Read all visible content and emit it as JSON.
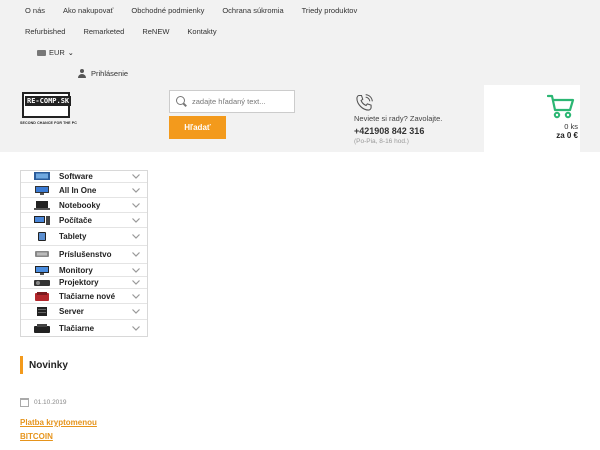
{
  "topnav": {
    "row1": [
      "O nás",
      "Ako nakupovať",
      "Obchodné podmienky",
      "Ochrana súkromia",
      "Triedy produktov"
    ],
    "row2": [
      "Refurbished",
      "Remarketed",
      "ReNEW",
      "Kontakty"
    ]
  },
  "currency": {
    "label": "EUR"
  },
  "account": {
    "login_label": "Prihlásenie"
  },
  "logo": {
    "text": "RE-COMP.SK",
    "tagline": "SECOND CHANCE FOR THE PC"
  },
  "search": {
    "placeholder": "zadajte hľadaný text...",
    "button_label": "Hľadať"
  },
  "contact": {
    "question": "Neviete si rady? Zavolajte.",
    "phone": "+421908 842 316",
    "hours": "(Po-Pia, 8-16 hod.)"
  },
  "cart": {
    "count": "0 ks",
    "total": "za 0 €",
    "accent": "#2bb673"
  },
  "categories": [
    {
      "label": "Software",
      "icon": "software-icon"
    },
    {
      "label": "All In One",
      "icon": "all-in-one-icon"
    },
    {
      "label": "Notebooky",
      "icon": "laptop-icon"
    },
    {
      "label": "Počítače",
      "icon": "desktop-icon"
    },
    {
      "label": "Tablety",
      "icon": "tablet-icon"
    },
    {
      "label": "Príslušenstvo",
      "icon": "accessories-icon"
    },
    {
      "label": "Monitory",
      "icon": "monitor-icon"
    },
    {
      "label": "Projektory",
      "icon": "projector-icon"
    },
    {
      "label": "Tlačiarne nové",
      "icon": "printer-new-icon"
    },
    {
      "label": "Server",
      "icon": "server-icon"
    },
    {
      "label": "Tlačiarne",
      "icon": "printer-icon"
    }
  ],
  "news": {
    "heading": "Novinky",
    "date": "01.10.2019",
    "title_line1": "Platba kryptomenou",
    "title_line2": "BITCOIN"
  },
  "colors": {
    "accent": "#f39a1c",
    "header_bg": "#f2f2f2"
  }
}
